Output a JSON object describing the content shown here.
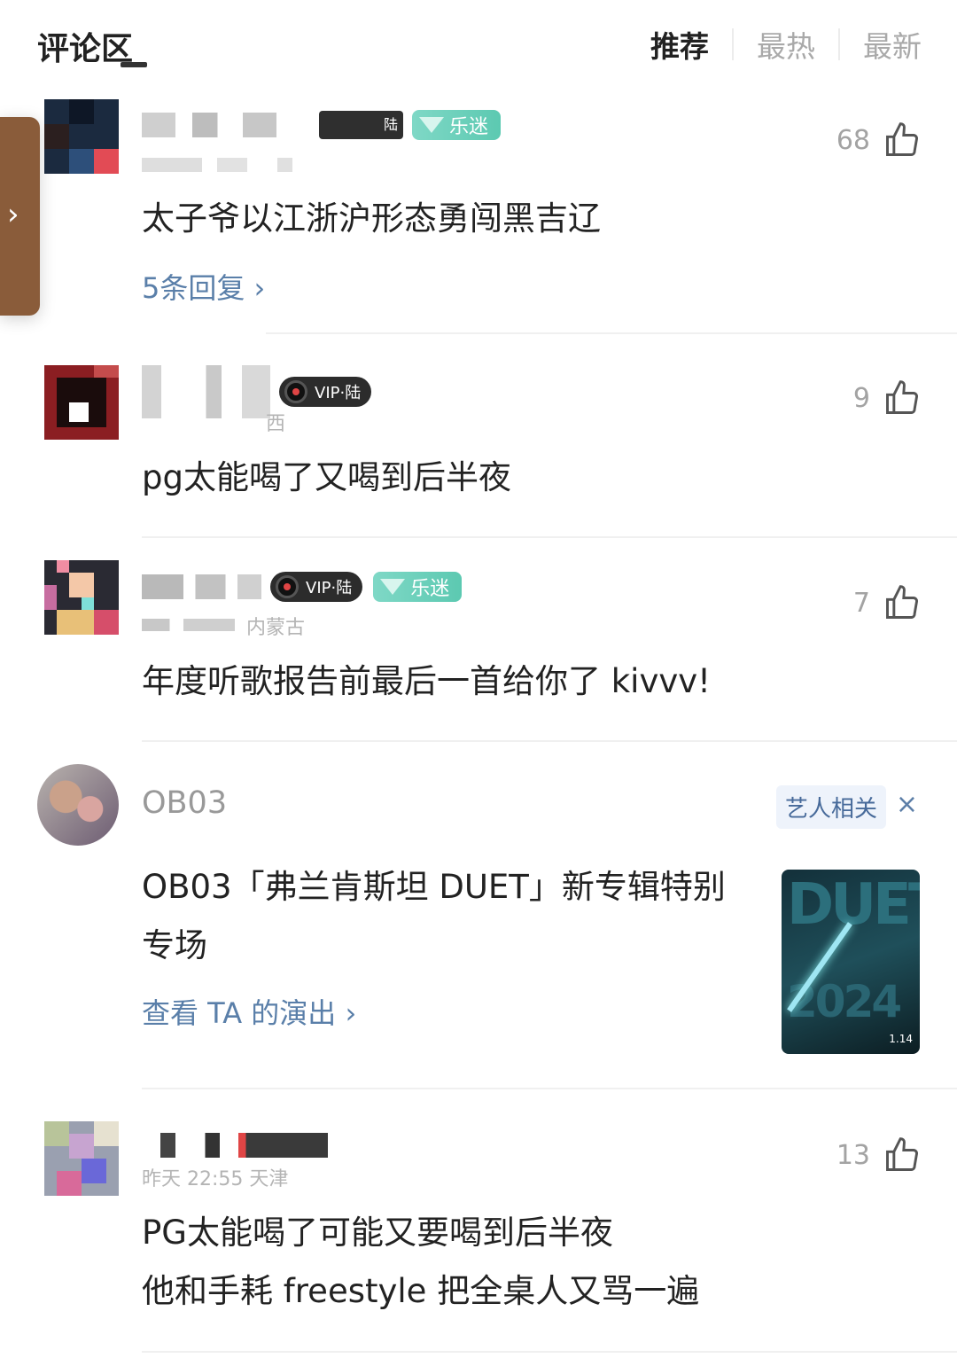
{
  "header": {
    "title": "评论区",
    "tabs": [
      {
        "label": "推荐",
        "active": true
      },
      {
        "label": "最热",
        "active": false
      },
      {
        "label": "最新",
        "active": false
      }
    ]
  },
  "side_handle": {
    "icon": "chevron-right-icon",
    "glyph": "›"
  },
  "comments": [
    {
      "name_suffix": "陆",
      "badges": {
        "fan": "乐迷"
      },
      "likes": "68",
      "text": "太子爷以江浙沪形态勇闯黑吉辽",
      "replies": "5条回复 ›"
    },
    {
      "name_suffix": "西",
      "badges": {
        "vip": "VIP·陆"
      },
      "likes": "9",
      "text": "pg太能喝了又喝到后半夜"
    },
    {
      "sub": "内蒙古",
      "badges": {
        "vip": "VIP·陆",
        "fan": "乐迷"
      },
      "likes": "7",
      "text": "年度听歌报告前最后一首给你了 kivvv!"
    },
    {
      "sub": "昨天 22:55 天津",
      "likes": "13",
      "text_lines": [
        "PG太能喝了可能又要喝到后半夜",
        "他和手耗 freestyle 把全桌人又骂一遍"
      ]
    }
  ],
  "artist_card": {
    "name": "OB03",
    "tag": "艺人相关",
    "close": "×",
    "text_line1": "OB03「弗兰肯斯坦 DUET」新专辑特别",
    "text_line2": "专场",
    "link": "查看 TA 的演出 ›",
    "poster": {
      "big": "DUET",
      "year": "2024",
      "date": "1.14"
    }
  },
  "colors": {
    "accent_link": "#5a7fa9",
    "fan_badge": "#5cc9b1",
    "vip_badge": "#2c2c2c"
  }
}
